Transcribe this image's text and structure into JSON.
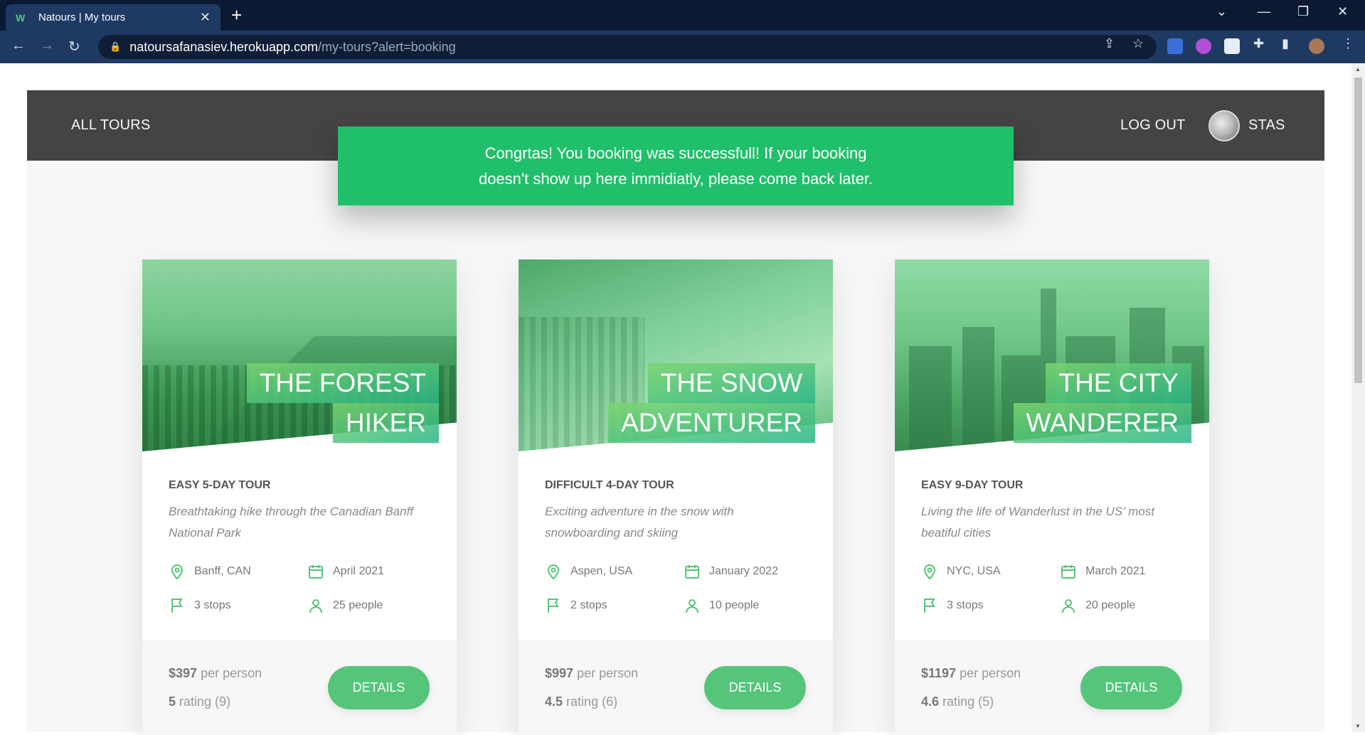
{
  "browser": {
    "tab_title": "Natours | My tours",
    "url_host": "natoursafanasiev.herokuapp.com",
    "url_path": "/my-tours?alert=booking"
  },
  "header": {
    "all_tours": "All tours",
    "log_out": "Log out",
    "user_name": "STAS"
  },
  "alert": {
    "line1": "Congrtas! You booking was successfull! If your booking",
    "line2": "doesn't show up here immidiatly, please come back later."
  },
  "colors": {
    "primary": "#55c57a",
    "alert": "#20bf6b",
    "header": "#444444"
  },
  "cards": [
    {
      "title_line1": "The Forest",
      "title_line2": "Hiker",
      "subheading": "Easy 5-day tour",
      "summary": "Breathtaking hike through the Canadian Banff National Park",
      "location": "Banff, CAN",
      "date": "April 2021",
      "stops": "3 stops",
      "people": "25 people",
      "price": "$397",
      "price_unit": "per person",
      "rating": "5",
      "rating_label": "rating (9)",
      "button": "Details"
    },
    {
      "title_line1": "The Snow",
      "title_line2": "Adventurer",
      "subheading": "Difficult 4-day tour",
      "summary": "Exciting adventure in the snow with snowboarding and skiing",
      "location": "Aspen, USA",
      "date": "January 2022",
      "stops": "2 stops",
      "people": "10 people",
      "price": "$997",
      "price_unit": "per person",
      "rating": "4.5",
      "rating_label": "rating (6)",
      "button": "Details"
    },
    {
      "title_line1": "The City",
      "title_line2": "Wanderer",
      "subheading": "Easy 9-day tour",
      "summary": "Living the life of Wanderlust in the US' most beatiful cities",
      "location": "NYC, USA",
      "date": "March 2021",
      "stops": "3 stops",
      "people": "20 people",
      "price": "$1197",
      "price_unit": "per person",
      "rating": "4.6",
      "rating_label": "rating (5)",
      "button": "Details"
    }
  ]
}
